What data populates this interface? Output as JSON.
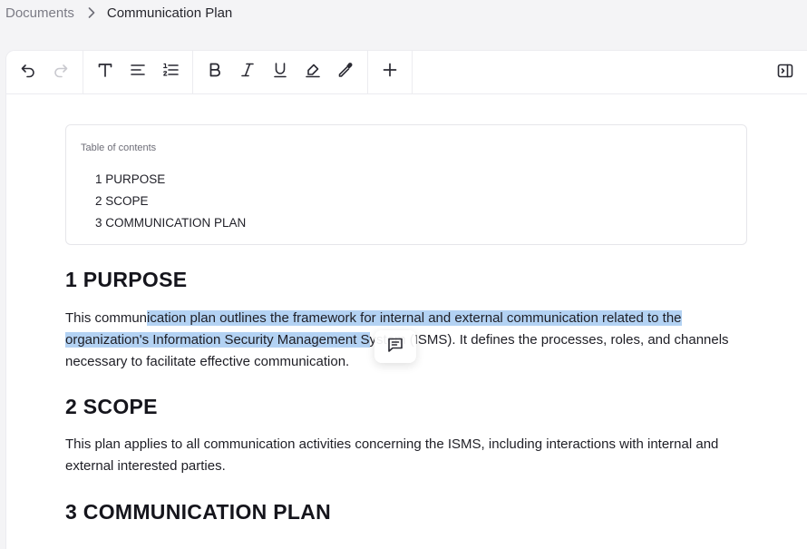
{
  "breadcrumb": {
    "parent": "Documents",
    "current": "Communication Plan"
  },
  "toolbar": {
    "icons": [
      "undo-icon",
      "redo-icon",
      "text-style-icon",
      "align-icon",
      "numbered-list-icon",
      "bold-icon",
      "italic-icon",
      "underline-icon",
      "highlight-icon",
      "color-picker-icon",
      "plus-icon",
      "sidebar-toggle-icon"
    ]
  },
  "toc": {
    "title": "Table of contents",
    "items": [
      "1 PURPOSE",
      "2 SCOPE",
      "3 COMMUNICATION PLAN"
    ]
  },
  "sections": [
    {
      "heading": "1 PURPOSE",
      "text_before": "This commun",
      "text_selected_1": "ication plan outlines the framework for internal and external communication related to the ",
      "text_selected_2": "organization's Information Security Management S",
      "text_after": "ystem (ISMS). It defines the processes, roles, and channels necessary to facilitate effective communication."
    },
    {
      "heading": "2 SCOPE",
      "text": "This plan applies to all communication activities concerning the ISMS, including interactions with internal and external interested parties."
    },
    {
      "heading": "3 COMMUNICATION PLAN"
    }
  ],
  "selection_color": "#b3d2f3"
}
